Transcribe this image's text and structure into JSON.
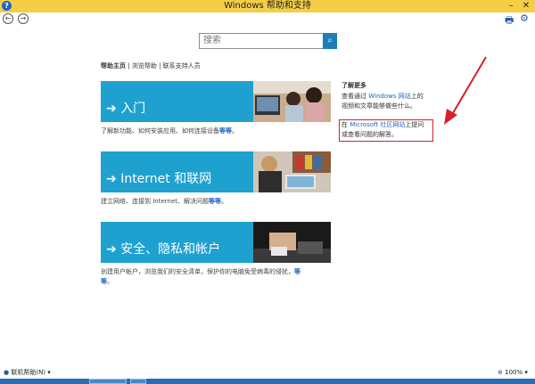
{
  "window": {
    "title": "Windows 帮助和支持",
    "help_glyph": "?",
    "minimize": "–",
    "close": "✕"
  },
  "toolbar": {
    "back": "←",
    "forward": "→",
    "print_glyph": "🖶",
    "settings_glyph": "⚙"
  },
  "search": {
    "placeholder": "搜索",
    "button_glyph": "⌕"
  },
  "links": {
    "home": "帮助主页",
    "browse": "浏览帮助",
    "contact": "联系支持人员"
  },
  "tiles": [
    {
      "label": "入门",
      "desc_main": "了解新功能、如何安装应用、如何连接设备",
      "desc_more": "等等",
      "desc_end": "。"
    },
    {
      "label": "Internet 和联网",
      "desc_main": "建立网络、连接到 Internet、解决问题",
      "desc_more": "等等",
      "desc_end": "。"
    },
    {
      "label": "安全、隐私和帐户",
      "desc_main": "创建用户帐户，浏览我们的安全清单，保护你的电脑免受病毒的侵扰，",
      "desc_more": "等",
      "desc_more2": "等",
      "desc_end": "。"
    }
  ],
  "sidebar": {
    "title": "了解更多",
    "line1_pre": "查看通过 ",
    "line1_link": "Windows 网站",
    "line1_post": "上的",
    "line2": "视频和文章能够做些什么。",
    "line3_pre": "在 ",
    "line3_link": "Microsoft 社区网站",
    "line3_post": "上提问",
    "line4": "或查看问题的解答。"
  },
  "statusbar": {
    "offline_help": "联机帮助(N)",
    "zoom": "100%"
  },
  "colors": {
    "titlebar": "#f4ce46",
    "tile_blue": "#1fa1cf",
    "link_blue": "#1f63c6",
    "annotation_red": "#d6202a",
    "taskbar": "#2b6bb4"
  }
}
